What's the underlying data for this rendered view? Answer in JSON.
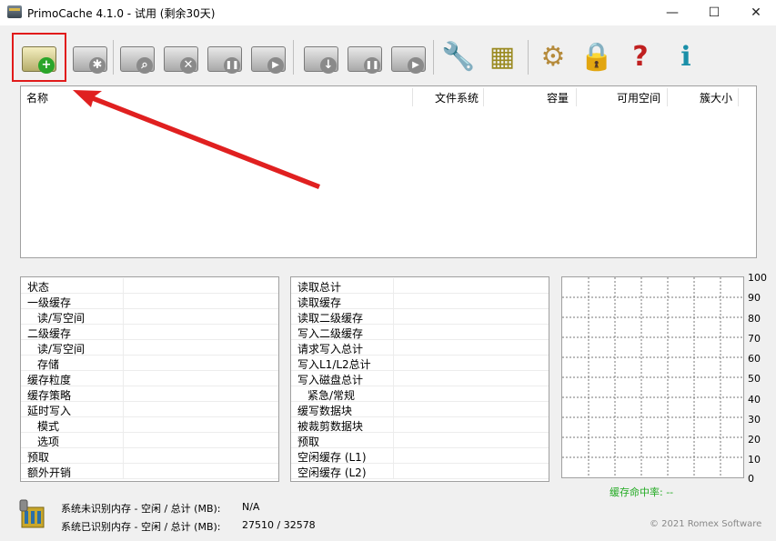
{
  "window": {
    "title": "PrimoCache 4.1.0 - 试用 (剩余30天)",
    "controls": {
      "minimize": "—",
      "maximize": "☐",
      "close": "✕"
    }
  },
  "toolbar": {
    "buttons": [
      {
        "name": "create-cache-task",
        "icon": "disk-add-icon",
        "glyph": "+"
      },
      {
        "name": "cache-settings",
        "icon": "disk-gear-icon",
        "glyph": "✱"
      },
      {
        "name": "view-task",
        "icon": "disk-search-icon",
        "glyph": "⌕"
      },
      {
        "name": "delete-task",
        "icon": "disk-delete-icon",
        "glyph": "✕"
      },
      {
        "name": "pause-task",
        "icon": "disk-pause-icon",
        "glyph": "❚❚"
      },
      {
        "name": "resume-task",
        "icon": "disk-play-icon",
        "glyph": "▶"
      },
      {
        "name": "flush-task",
        "icon": "disk-download-icon",
        "glyph": "↓"
      },
      {
        "name": "pause-deferred-write",
        "icon": "disk-timer-pause-icon",
        "glyph": "❚❚"
      },
      {
        "name": "resume-deferred-write",
        "icon": "disk-timer-play-icon",
        "glyph": "▶"
      },
      {
        "name": "tools",
        "icon": "wrench-disk-icon",
        "glyph": "🔧"
      },
      {
        "name": "memory",
        "icon": "memory-chip-icon",
        "glyph": "▦"
      },
      {
        "name": "options",
        "icon": "box-gear-icon",
        "glyph": "⚙"
      },
      {
        "name": "license",
        "icon": "key-lock-icon",
        "glyph": "🔒"
      },
      {
        "name": "help",
        "icon": "help-book-icon",
        "glyph": "?"
      },
      {
        "name": "about",
        "icon": "info-icon",
        "glyph": "ℹ"
      }
    ]
  },
  "volume_list": {
    "columns": [
      "名称",
      "文件系统",
      "容量",
      "可用空间",
      "簇大小"
    ]
  },
  "stats_left": [
    "状态",
    "一级缓存",
    "读/写空间",
    "二级缓存",
    "读/写空间",
    "存储",
    "缓存粒度",
    "缓存策略",
    "延时写入",
    "模式",
    "选项",
    "预取",
    "额外开销"
  ],
  "stats_right": [
    "读取总计",
    "读取缓存",
    "读取二级缓存",
    "写入二级缓存",
    "请求写入总计",
    "写入L1/L2总计",
    "写入磁盘总计",
    "紧急/常规",
    "缓写数据块",
    "被裁剪数据块",
    "预取",
    "空闲缓存 (L1)",
    "空闲缓存 (L2)"
  ],
  "graph": {
    "ticks": [
      "100",
      "90",
      "80",
      "70",
      "60",
      "50",
      "40",
      "30",
      "20",
      "10",
      "0"
    ],
    "hit_rate_label": "缓存命中率: --"
  },
  "memory": {
    "unrecognized_label": "系统未识别内存 - 空闲 / 总计 (MB):",
    "unrecognized_value": "N/A",
    "recognized_label": "系统已识别内存 - 空闲 / 总计 (MB):",
    "recognized_value": "27510 / 32578"
  },
  "footer": {
    "copyright": "© 2021 Romex Software"
  },
  "colors": {
    "highlight": "#e11b1b",
    "arrow": "#e02020",
    "hit_rate": "#22aa22"
  }
}
